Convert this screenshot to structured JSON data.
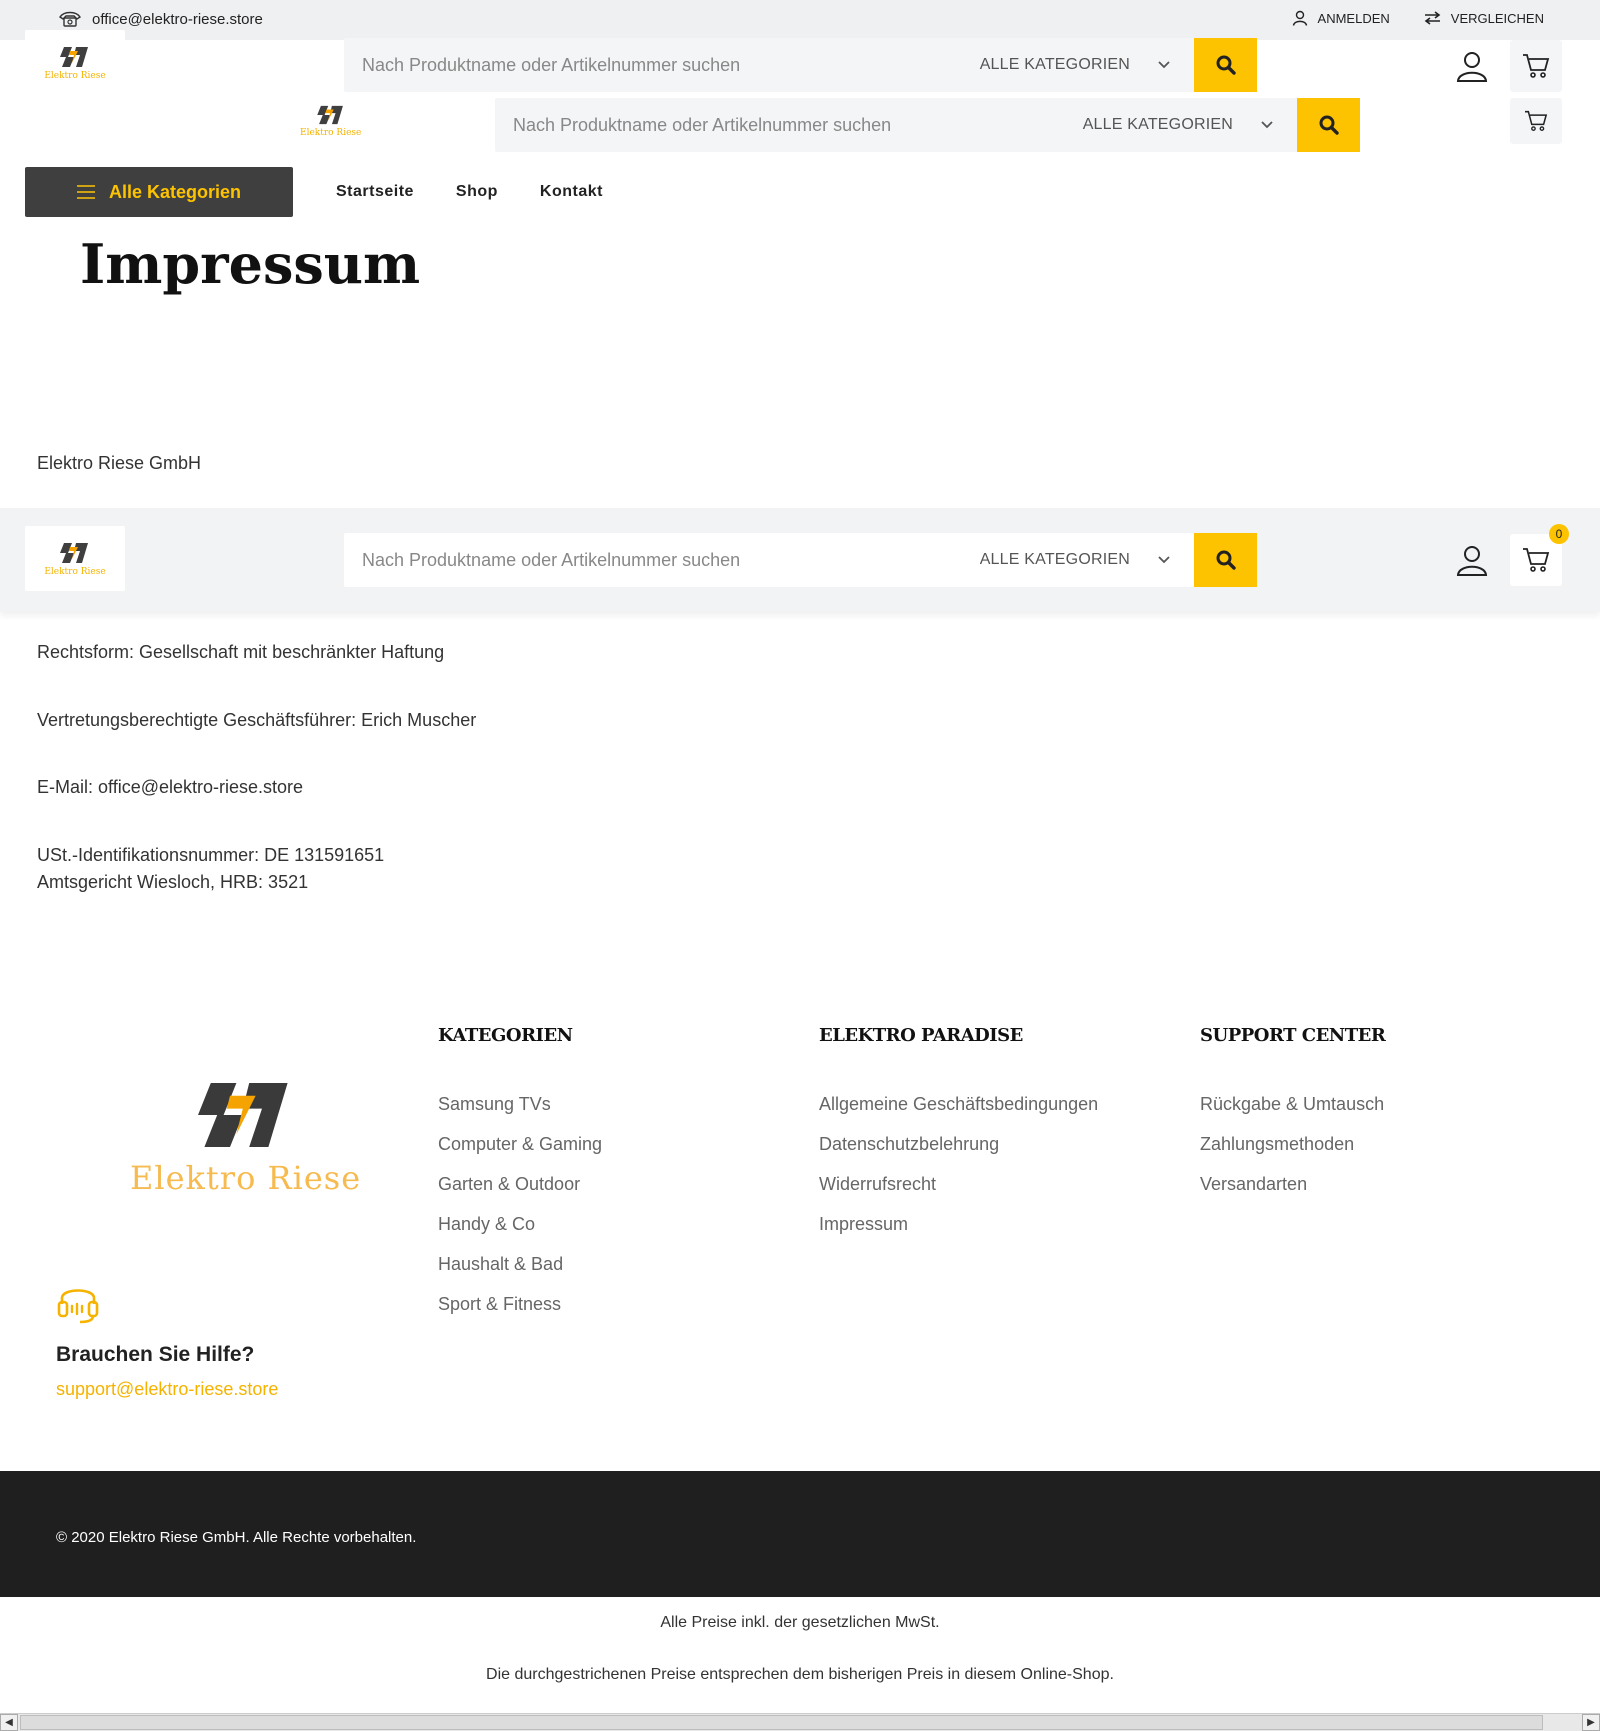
{
  "topbar": {
    "email": "office@elektro-riese.store",
    "login": "ANMELDEN",
    "compare": "VERGLEICHEN"
  },
  "header": {
    "logo_text": "Elektro Riese",
    "search_placeholder": "Nach Produktname oder Artikelnummer suchen",
    "category_select": "ALLE KATEGORIEN",
    "cart_count": "0"
  },
  "nav": {
    "all_categories": "Alle Kategorien",
    "items": [
      "Startseite",
      "Shop",
      "Kontakt"
    ]
  },
  "page": {
    "title": "Impressum",
    "company": "Elektro Riese GmbH",
    "legal_form": "Rechtsform: Gesellschaft mit beschränkter Haftung",
    "managers": "Vertretungsberechtigte Geschäftsführer: Erich Muscher",
    "email": "E-Mail: office@elektro-riese.store",
    "vat": "USt.-Identifikationsnummer: DE 131591651",
    "court": "Amtsgericht Wiesloch, HRB: 3521"
  },
  "footer": {
    "logo_text": "Elektro Riese",
    "help_title": "Brauchen Sie Hilfe?",
    "help_email": "support@elektro-riese.store",
    "columns": [
      {
        "title": "KATEGORIEN",
        "links": [
          "Samsung TVs",
          "Computer & Gaming",
          "Garten & Outdoor",
          "Handy & Co",
          "Haushalt & Bad",
          "Sport & Fitness"
        ]
      },
      {
        "title": "ELEKTRO PARADISE",
        "links": [
          "Allgemeine Geschäftsbedingungen",
          "Datenschutzbelehrung",
          "Widerrufsrecht",
          "Impressum"
        ]
      },
      {
        "title": "SUPPORT CENTER",
        "links": [
          "Rückgabe & Umtausch",
          "Zahlungsmethoden",
          "Versandarten"
        ]
      }
    ],
    "copyright": "© 2020 Elektro Riese GmbH. Alle Rechte vorbehalten.",
    "note_vat": "Alle Preise inkl. der gesetzlichen MwSt.",
    "note_prices": "Die durchgestrichenen Preise entsprechen dem bisherigen Preis in diesem Online-Shop."
  },
  "colors": {
    "accent": "#fdc300",
    "dark": "#1f1f1f",
    "nav_button": "#3f3f3f"
  }
}
